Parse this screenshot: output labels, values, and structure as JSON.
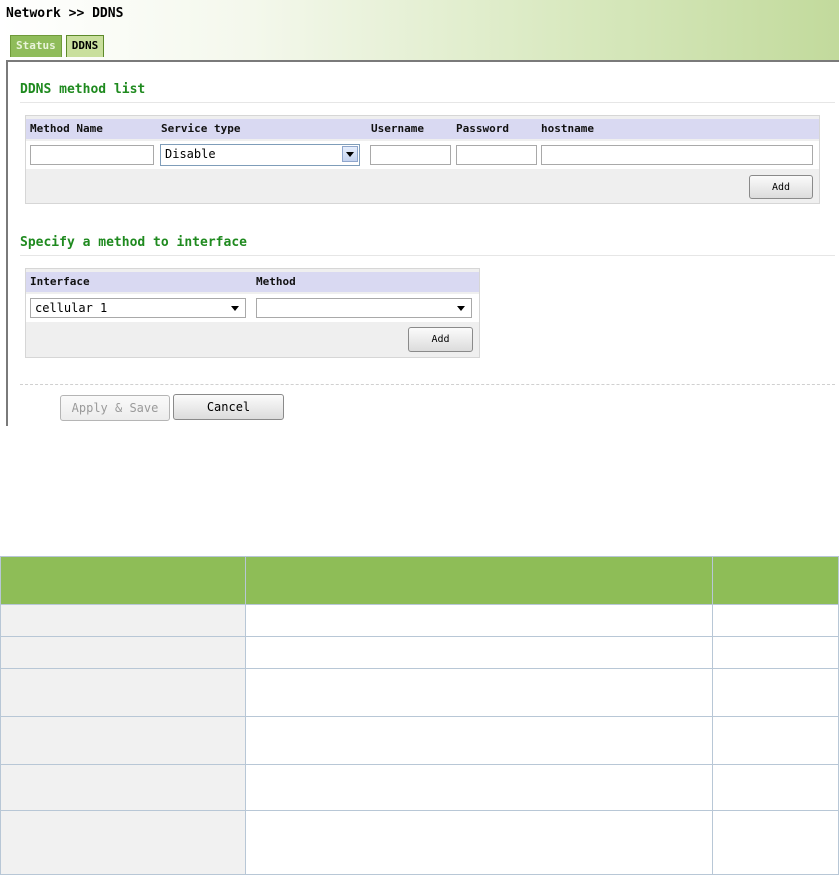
{
  "header": {
    "breadcrumb": "Network >> DDNS",
    "tabs": [
      {
        "label": "Status",
        "active": false
      },
      {
        "label": "DDNS",
        "active": true
      }
    ]
  },
  "ddns_method_list": {
    "title": "DDNS method list",
    "columns": [
      "Method Name",
      "Service type",
      "Username",
      "Password",
      "hostname"
    ],
    "row": {
      "method_name": "",
      "service_type": "Disable",
      "username": "",
      "password": "",
      "hostname": ""
    },
    "add_label": "Add"
  },
  "interface_section": {
    "title": "Specify a method to interface",
    "columns": [
      "Interface",
      "Method"
    ],
    "row": {
      "interface": "cellular 1",
      "method": ""
    },
    "add_label": "Add"
  },
  "actions": {
    "apply_label": "Apply & Save",
    "cancel_label": "Cancel"
  },
  "colors": {
    "accent_green": "#1f8a1f",
    "table_header": "#8ebd57",
    "column_header_bg": "#d9d9f2"
  }
}
